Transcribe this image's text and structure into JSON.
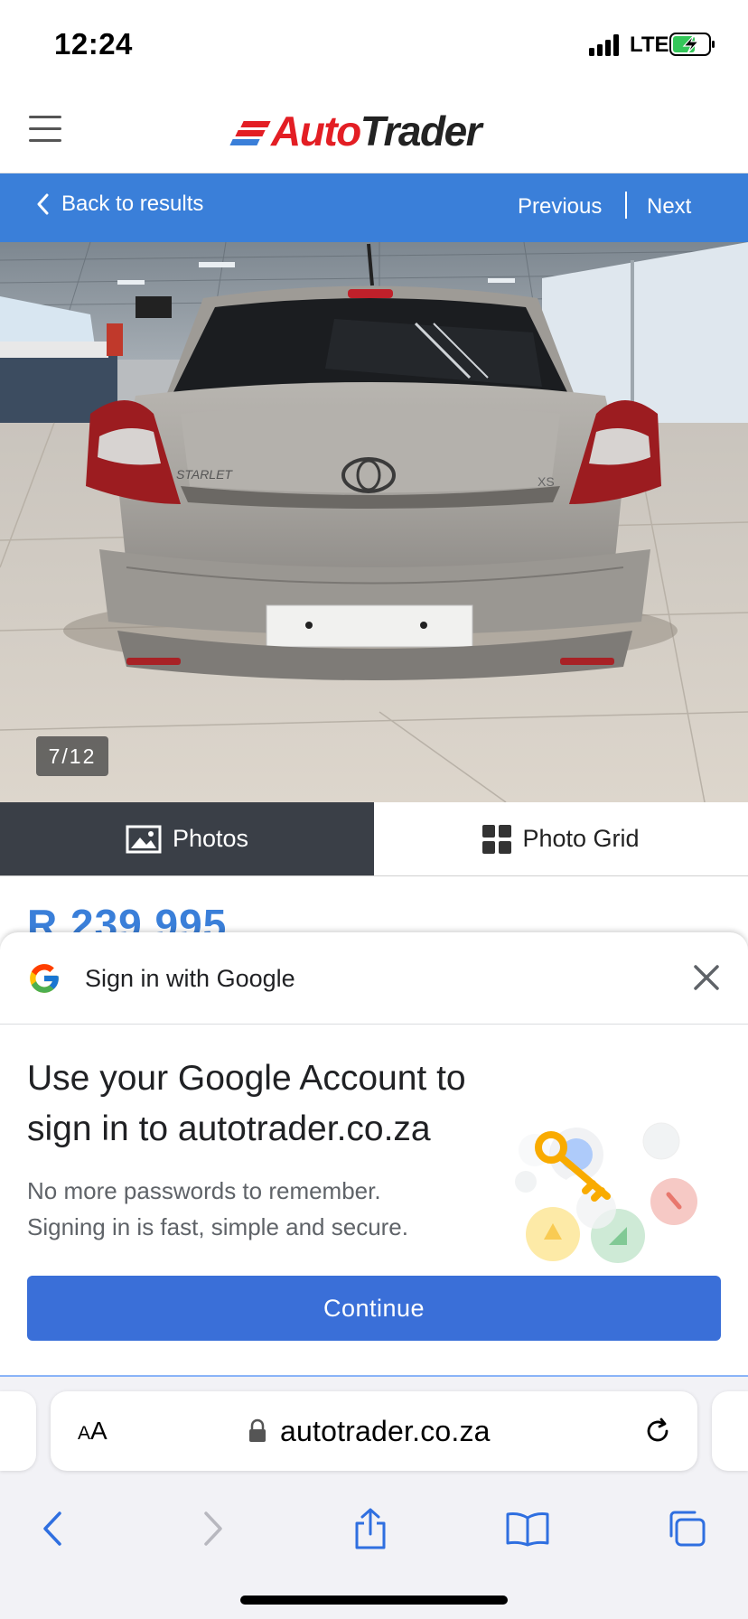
{
  "status_bar": {
    "time": "12:24",
    "network": "LTE",
    "icons": [
      "signal-icon",
      "battery-charging-icon"
    ]
  },
  "header": {
    "logo_auto": "Auto",
    "logo_trader": "Trader",
    "menu_icon": "hamburger-menu-icon",
    "brand_colors": {
      "red": "#e31e24",
      "blue": "#3a7fd9",
      "dark": "#222222"
    }
  },
  "nav": {
    "back_label": "Back to results",
    "previous_label": "Previous",
    "next_label": "Next",
    "background": "#3a7fd9"
  },
  "gallery": {
    "counter": "7/12",
    "image_subject": "rear view of a silver Toyota Starlet hatchback in a showroom"
  },
  "tabs": {
    "photos_label": "Photos",
    "grid_label": "Photo Grid",
    "active": "Photos"
  },
  "listing": {
    "price": "R 239 995"
  },
  "google_sheet": {
    "title": "Sign in with Google",
    "headline": "Use your Google Account to sign in to autotrader.co.za",
    "subtext": "No more passwords to remember. Signing in is fast, simple and secure.",
    "continue_label": "Continue",
    "button_color": "#3a6fd8"
  },
  "browser": {
    "aa_small": "A",
    "aa_large": "A",
    "url": "autotrader.co.za",
    "toolbar_icons": [
      "back-icon",
      "forward-icon",
      "share-icon",
      "bookmarks-icon",
      "tabs-icon"
    ]
  }
}
